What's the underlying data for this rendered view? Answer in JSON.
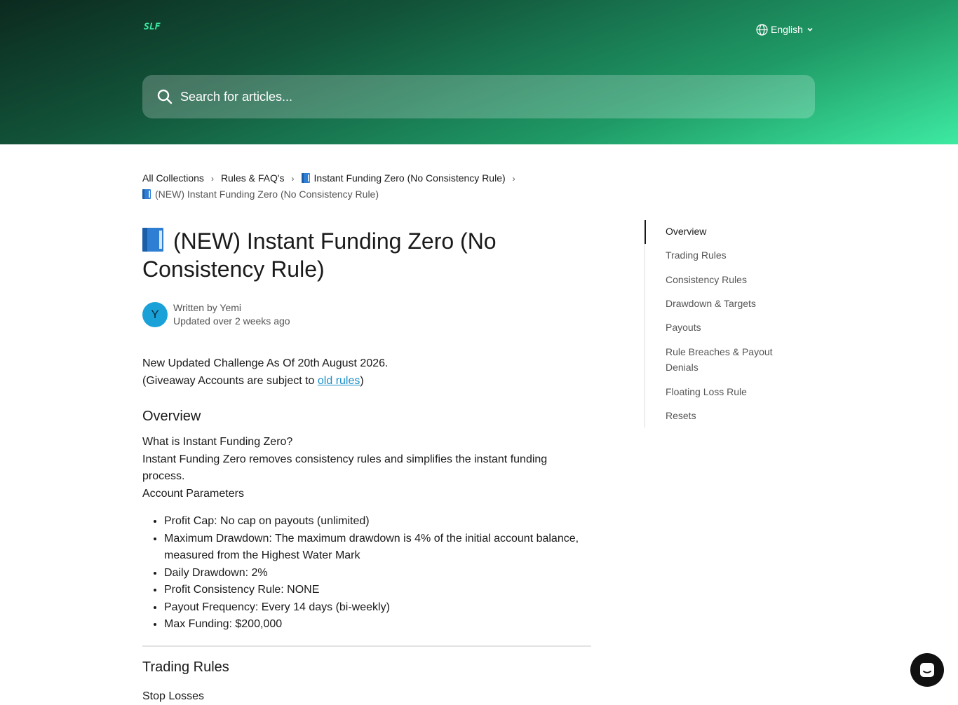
{
  "header": {
    "logo_text": "SLF",
    "language_label": "English",
    "search": {
      "placeholder": "Search for articles..."
    },
    "accent_color": "#3deaa2"
  },
  "breadcrumb": {
    "items": [
      "All Collections",
      "Rules & FAQ's",
      "Instant Funding Zero (No Consistency Rule)"
    ],
    "current": "(NEW) Instant Funding Zero (No Consistency Rule)"
  },
  "article": {
    "title": "(NEW) Instant Funding Zero (No Consistency Rule)",
    "author": {
      "avatar_initial": "Y",
      "written_by": "Written by Yemi",
      "updated": "Updated over 2 weeks ago"
    },
    "intro_line": "New Updated Challenge As Of 20th August 2026.",
    "giveaway_prefix": "(Giveaway Accounts are subject to ",
    "giveaway_link": "old rules",
    "giveaway_suffix": ")",
    "overview_heading": "Overview",
    "overview_q": "What is Instant Funding Zero?",
    "overview_a": "Instant Funding Zero removes consistency rules and simplifies the instant funding process.",
    "params_heading": "Account Parameters",
    "params": [
      "Profit Cap: No cap on payouts (unlimited)",
      "Maximum Drawdown: The maximum drawdown is 4% of the initial account balance, measured from the Highest Water Mark",
      "Daily Drawdown: 2%",
      "Profit Consistency Rule: NONE",
      "Payout Frequency: Every 14 days (bi-weekly)",
      "Max Funding: $200,000"
    ],
    "trading_heading": "Trading Rules",
    "stop_losses": "Stop Losses"
  },
  "toc": {
    "items": [
      "Overview",
      "Trading Rules",
      "Consistency Rules",
      "Drawdown & Targets",
      "Payouts",
      "Rule Breaches & Payout Denials",
      "Floating Loss Rule",
      "Resets"
    ],
    "active_index": 0
  },
  "icons": {
    "globe": "globe-icon",
    "chevron": "chevron-down-icon",
    "search": "search-icon",
    "book": "blue-book-icon",
    "chat": "chat-icon"
  }
}
